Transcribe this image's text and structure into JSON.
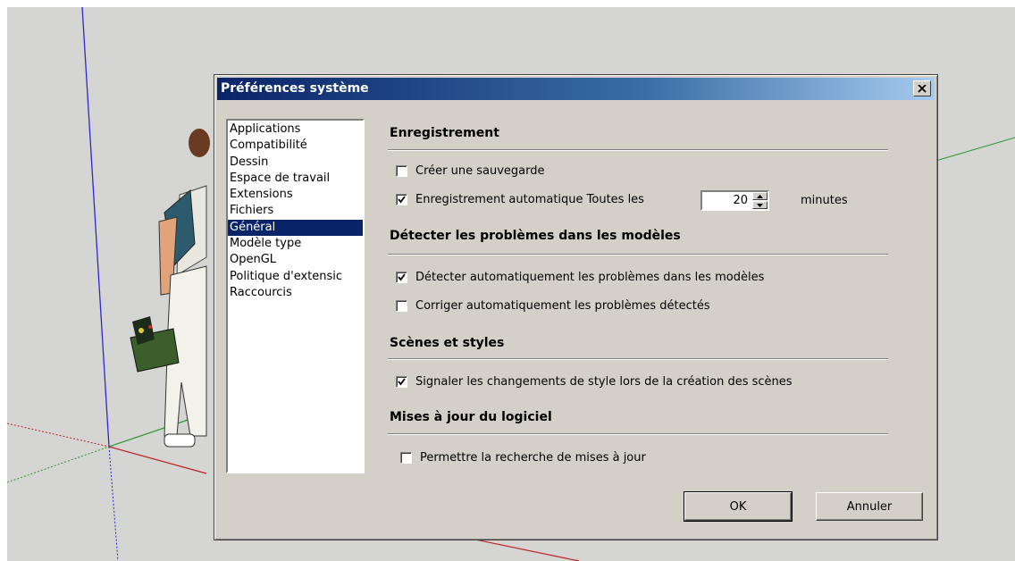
{
  "dialog": {
    "title": "Préférences système",
    "close_icon": "close-x-icon"
  },
  "sidebar": {
    "items": [
      {
        "label": "Applications"
      },
      {
        "label": "Compatibilité"
      },
      {
        "label": "Dessin"
      },
      {
        "label": "Espace de travail"
      },
      {
        "label": "Extensions"
      },
      {
        "label": "Fichiers"
      },
      {
        "label": "Général",
        "selected": true
      },
      {
        "label": "Modèle type"
      },
      {
        "label": "OpenGL"
      },
      {
        "label": "Politique d'extensic"
      },
      {
        "label": "Raccourcis"
      }
    ]
  },
  "sections": {
    "saving": {
      "title": "Enregistrement",
      "create_backup": {
        "label": "Créer une sauvegarde",
        "checked": false
      },
      "autosave": {
        "label": "Enregistrement automatique Toutes les",
        "checked": true,
        "value": "20",
        "unit": "minutes"
      }
    },
    "problems": {
      "title": "Détecter les problèmes dans les modèles",
      "auto_detect": {
        "label": "Détecter automatiquement les problèmes dans les modèles",
        "checked": true
      },
      "auto_fix": {
        "label": "Corriger automatiquement les problèmes détectés",
        "checked": false
      }
    },
    "scenes": {
      "title": "Scènes et styles",
      "warn_style": {
        "label": "Signaler les changements de style lors de la création des scènes",
        "checked": true
      }
    },
    "updates": {
      "title": "Mises à jour du logiciel",
      "allow_check": {
        "label": "Permettre la recherche de mises à jour",
        "checked": false
      }
    }
  },
  "buttons": {
    "ok": "OK",
    "cancel": "Annuler"
  },
  "colors": {
    "title_bar_start": "#0a246a",
    "title_bar_end": "#a6caf0",
    "dialog_face": "#d4d0c8",
    "viewport_bg": "#d5d5d3",
    "selection": "#0a246a"
  }
}
